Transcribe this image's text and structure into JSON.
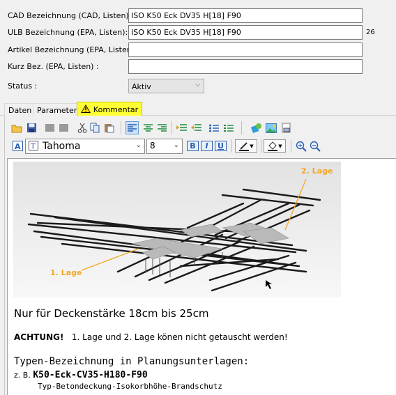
{
  "form": {
    "cad": {
      "label": "CAD Bezeichnung (CAD, Listen):",
      "value": "ISO K50 Eck DV35 H[18] F90"
    },
    "ulb": {
      "label": "ULB Bezeichnung (EPA, Listen):",
      "value": "ISO K50 Eck DV35 H[18] F90",
      "count": "26"
    },
    "artikel": {
      "label": "Artikel Bezeichnung (EPA, Listen):",
      "value": ""
    },
    "kurz": {
      "label": "Kurz Bez. (EPA, Listen) :",
      "value": ""
    },
    "status": {
      "label": "Status :",
      "value": "Aktiv"
    }
  },
  "tabs": [
    {
      "label": "Daten"
    },
    {
      "label": "Parameter"
    },
    {
      "label": "Kommentar",
      "icon": "warning-icon",
      "active": true
    }
  ],
  "toolbar": {
    "row1_icons": [
      "open-folder-icon",
      "save-icon",
      "disabled-icon",
      "disabled-icon",
      "cut-icon",
      "copy-icon",
      "paste-icon",
      "align-left-icon",
      "align-center-icon",
      "align-right-icon",
      "indent-icon",
      "outdent-icon",
      "bullet-list-icon",
      "numbered-list-icon",
      "insert-object-icon",
      "insert-image-icon",
      "print-preview-icon"
    ],
    "font_name": "Tahoma",
    "font_size": "8",
    "bold": "B",
    "italic": "I",
    "underline": "U"
  },
  "image": {
    "label_layer2": "2. Lage",
    "label_layer1": "1. Lage",
    "accent": "#f5a623"
  },
  "comment": {
    "line1": "Nur für Deckenstärke 18cm bis 25cm",
    "line2_bold": "ACHTUNG!",
    "line2_rest": "1. Lage und 2. Lage könen nicht getauscht werden!",
    "line3": "Typen-Bezeichnung in Planungsunterlagen:",
    "line4_prefix": "z. B.",
    "line4_code": "K50-Eck-CV35-H180-F90",
    "line5": "Typ-Betondeckung-Isokorbhöhe-Brandschutz"
  }
}
